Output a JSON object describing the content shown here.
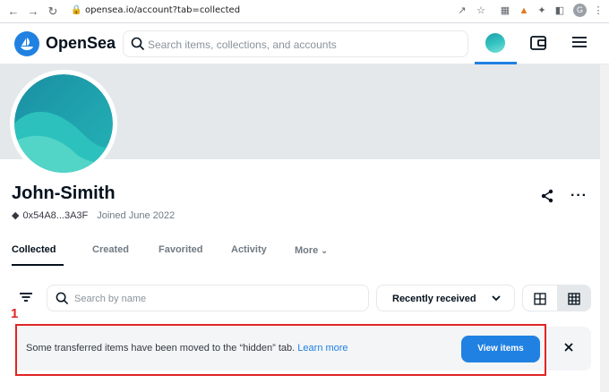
{
  "browser": {
    "url": "opensea.io/account?tab=collected"
  },
  "header": {
    "brand": "OpenSea",
    "search_placeholder": "Search items, collections, and accounts"
  },
  "profile": {
    "name": "John-Simith",
    "address": "0x54A8...3A3F",
    "joined": "Joined June 2022"
  },
  "tabs": [
    {
      "label": "Collected"
    },
    {
      "label": "Created"
    },
    {
      "label": "Favorited"
    },
    {
      "label": "Activity"
    },
    {
      "label": "More"
    }
  ],
  "toolbar": {
    "search_placeholder": "Search by name",
    "sort_label": "Recently received"
  },
  "annotation": {
    "marker": "1"
  },
  "notice": {
    "message": "Some transferred items have been moved to the “hidden” tab.",
    "link": "Learn more",
    "button": "View items"
  },
  "colors": {
    "accent": "#2081e2",
    "highlight": "#e02424"
  }
}
